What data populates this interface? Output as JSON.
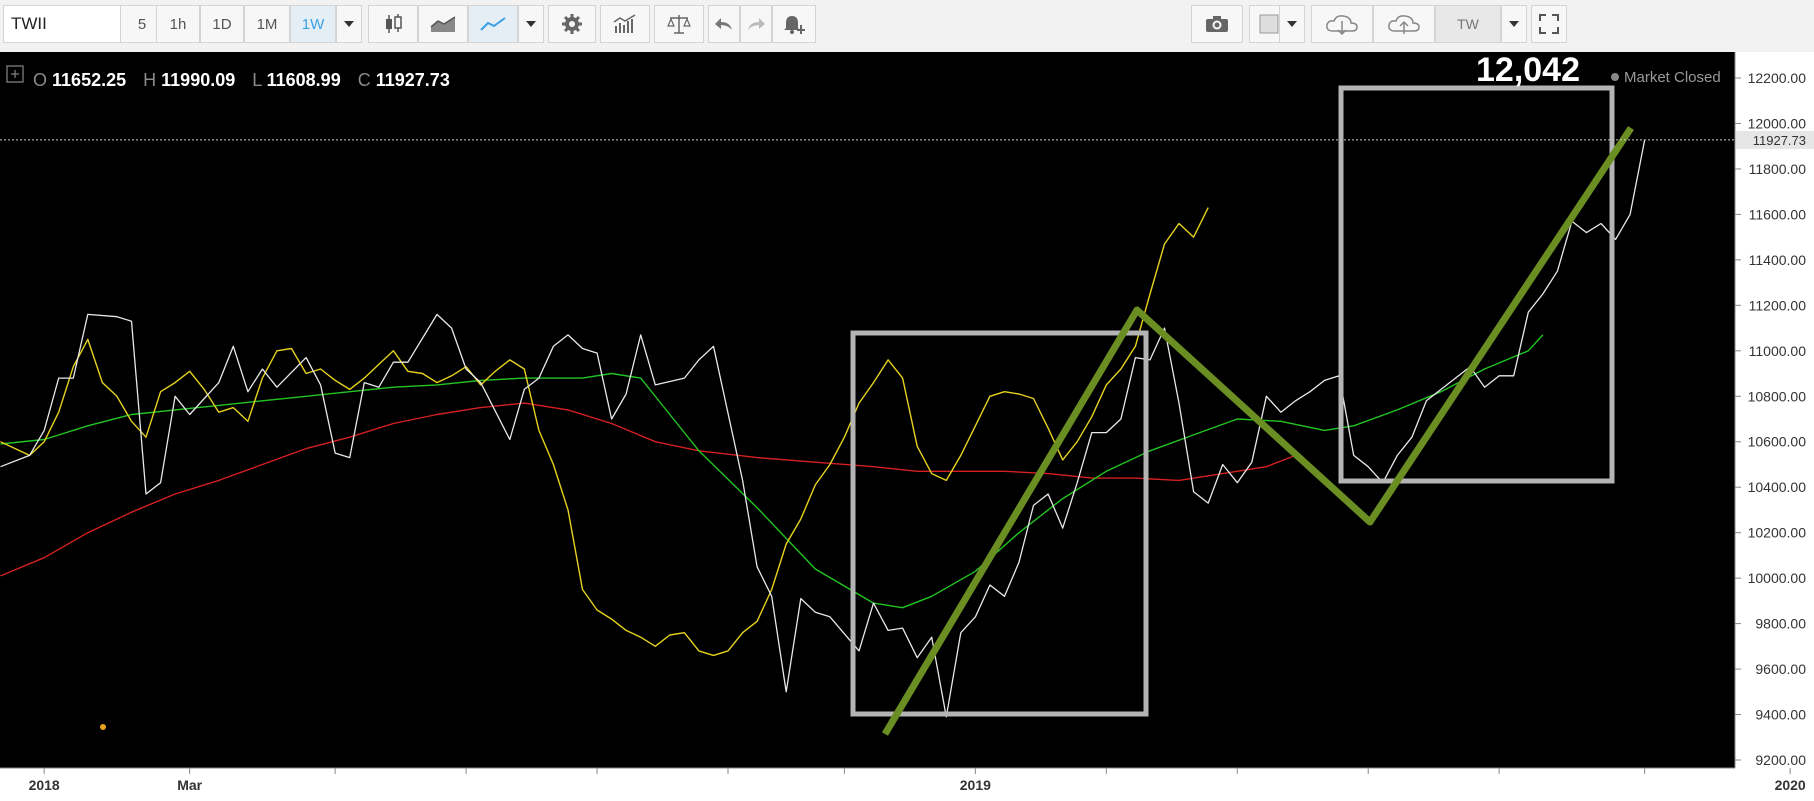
{
  "toolbar": {
    "symbol": "TWII",
    "intervals": [
      "5",
      "1h",
      "1D",
      "1M",
      "1W"
    ],
    "active_interval": "1W",
    "exchange": "TW"
  },
  "ohlc": {
    "o_label": "O",
    "o": "11652.25",
    "h_label": "H",
    "h": "11990.09",
    "l_label": "L",
    "l": "11608.99",
    "c_label": "C",
    "c": "11927.73"
  },
  "annotation": "12,042",
  "status": "Market Closed",
  "last_price_label": "11927.73",
  "colors": {
    "background": "#000000",
    "price": "#e8e8e8",
    "ma_fast": "#e6d21e",
    "ma_mid": "#22c422",
    "ma_slow": "#d42020",
    "trendline": "#6b8e23",
    "box": "#b4b4b4"
  },
  "chart_data": {
    "type": "line",
    "title": "",
    "xlabel": "",
    "ylabel": "",
    "ylim": [
      9150,
      12250
    ],
    "y_ticks": [
      "9200.00",
      "9400.00",
      "9600.00",
      "9800.00",
      "10000.00",
      "10200.00",
      "10400.00",
      "10600.00",
      "10800.00",
      "11000.00",
      "11200.00",
      "11400.00",
      "11600.00",
      "11800.00",
      "12000.00",
      "12200.00"
    ],
    "x_tick_labels": [
      {
        "label": "2018",
        "week": 3
      },
      {
        "label": "Mar",
        "week": 13
      },
      {
        "label": "2019",
        "week": 67
      },
      {
        "label": "2020",
        "week": 123
      }
    ],
    "x_week_range": [
      0,
      125
    ],
    "series": [
      {
        "name": "",
        "key": "price",
        "values": [
          [
            0,
            10490
          ],
          [
            2,
            10540
          ],
          [
            3,
            10650
          ],
          [
            4,
            10880
          ],
          [
            5,
            10880
          ],
          [
            6,
            11160
          ],
          [
            8,
            11150
          ],
          [
            9,
            11130
          ],
          [
            10,
            10370
          ],
          [
            11,
            10420
          ],
          [
            12,
            10800
          ],
          [
            13,
            10720
          ],
          [
            15,
            10860
          ],
          [
            16,
            11020
          ],
          [
            17,
            10820
          ],
          [
            18,
            10920
          ],
          [
            19,
            10840
          ],
          [
            21,
            10970
          ],
          [
            22,
            10850
          ],
          [
            23,
            10550
          ],
          [
            24,
            10530
          ],
          [
            25,
            10860
          ],
          [
            26,
            10840
          ],
          [
            27,
            10950
          ],
          [
            28,
            10950
          ],
          [
            30,
            11160
          ],
          [
            31,
            11100
          ],
          [
            32,
            10920
          ],
          [
            33,
            10860
          ],
          [
            35,
            10610
          ],
          [
            36,
            10830
          ],
          [
            37,
            10880
          ],
          [
            38,
            11020
          ],
          [
            39,
            11070
          ],
          [
            40,
            11010
          ],
          [
            41,
            10990
          ],
          [
            42,
            10700
          ],
          [
            43,
            10810
          ],
          [
            44,
            11070
          ],
          [
            45,
            10850
          ],
          [
            47,
            10880
          ],
          [
            48,
            10960
          ],
          [
            49,
            11020
          ],
          [
            51,
            10430
          ],
          [
            52,
            10050
          ],
          [
            53,
            9920
          ],
          [
            54,
            9500
          ],
          [
            55,
            9910
          ],
          [
            56,
            9850
          ],
          [
            57,
            9830
          ],
          [
            59,
            9680
          ],
          [
            60,
            9890
          ],
          [
            61,
            9770
          ],
          [
            62,
            9780
          ],
          [
            63,
            9650
          ],
          [
            64,
            9740
          ],
          [
            65,
            9390
          ],
          [
            66,
            9760
          ],
          [
            67,
            9830
          ],
          [
            68,
            9970
          ],
          [
            69,
            9920
          ],
          [
            70,
            10070
          ],
          [
            71,
            10320
          ],
          [
            72,
            10370
          ],
          [
            73,
            10220
          ],
          [
            74,
            10420
          ],
          [
            75,
            10640
          ],
          [
            76,
            10640
          ],
          [
            77,
            10700
          ],
          [
            78,
            10970
          ],
          [
            79,
            10960
          ],
          [
            80,
            11100
          ],
          [
            81,
            10770
          ],
          [
            82,
            10380
          ],
          [
            83,
            10330
          ],
          [
            84,
            10500
          ],
          [
            85,
            10420
          ],
          [
            86,
            10510
          ],
          [
            87,
            10800
          ],
          [
            88,
            10730
          ],
          [
            89,
            10780
          ],
          [
            90,
            10820
          ],
          [
            91,
            10870
          ],
          [
            92,
            10890
          ],
          [
            93,
            10540
          ],
          [
            94,
            10490
          ],
          [
            95,
            10420
          ],
          [
            96,
            10540
          ],
          [
            97,
            10620
          ],
          [
            98,
            10780
          ],
          [
            99,
            10830
          ],
          [
            101,
            10930
          ],
          [
            102,
            10840
          ],
          [
            103,
            10890
          ],
          [
            104,
            10890
          ],
          [
            105,
            11170
          ],
          [
            106,
            11250
          ],
          [
            107,
            11350
          ],
          [
            108,
            11570
          ],
          [
            109,
            11520
          ],
          [
            110,
            11560
          ],
          [
            111,
            11490
          ],
          [
            112,
            11600
          ],
          [
            113,
            11928
          ]
        ]
      },
      {
        "name": "",
        "key": "ma_fast",
        "values": [
          [
            0,
            10600
          ],
          [
            2,
            10540
          ],
          [
            3,
            10600
          ],
          [
            4,
            10730
          ],
          [
            5,
            10930
          ],
          [
            6,
            11050
          ],
          [
            7,
            10860
          ],
          [
            8,
            10800
          ],
          [
            9,
            10690
          ],
          [
            10,
            10620
          ],
          [
            11,
            10820
          ],
          [
            12,
            10860
          ],
          [
            13,
            10910
          ],
          [
            14,
            10830
          ],
          [
            15,
            10730
          ],
          [
            16,
            10750
          ],
          [
            17,
            10690
          ],
          [
            18,
            10880
          ],
          [
            19,
            11000
          ],
          [
            20,
            11010
          ],
          [
            21,
            10900
          ],
          [
            22,
            10920
          ],
          [
            23,
            10870
          ],
          [
            24,
            10830
          ],
          [
            25,
            10880
          ],
          [
            26,
            10940
          ],
          [
            27,
            11000
          ],
          [
            28,
            10910
          ],
          [
            29,
            10900
          ],
          [
            30,
            10860
          ],
          [
            31,
            10890
          ],
          [
            32,
            10930
          ],
          [
            33,
            10850
          ],
          [
            34,
            10910
          ],
          [
            35,
            10960
          ],
          [
            36,
            10920
          ],
          [
            37,
            10650
          ],
          [
            38,
            10500
          ],
          [
            39,
            10300
          ],
          [
            40,
            9950
          ],
          [
            41,
            9860
          ],
          [
            42,
            9820
          ],
          [
            43,
            9770
          ],
          [
            44,
            9740
          ],
          [
            45,
            9700
          ],
          [
            46,
            9750
          ],
          [
            47,
            9760
          ],
          [
            48,
            9680
          ],
          [
            49,
            9660
          ],
          [
            50,
            9680
          ],
          [
            51,
            9760
          ],
          [
            52,
            9810
          ],
          [
            53,
            9950
          ],
          [
            54,
            10150
          ],
          [
            55,
            10260
          ],
          [
            56,
            10410
          ],
          [
            57,
            10500
          ],
          [
            58,
            10620
          ],
          [
            59,
            10770
          ],
          [
            60,
            10860
          ],
          [
            61,
            10960
          ],
          [
            62,
            10880
          ],
          [
            63,
            10580
          ],
          [
            64,
            10460
          ],
          [
            65,
            10430
          ],
          [
            66,
            10540
          ],
          [
            67,
            10670
          ],
          [
            68,
            10800
          ],
          [
            69,
            10820
          ],
          [
            70,
            10810
          ],
          [
            71,
            10790
          ],
          [
            72,
            10660
          ],
          [
            73,
            10520
          ],
          [
            74,
            10600
          ],
          [
            75,
            10710
          ],
          [
            76,
            10850
          ],
          [
            77,
            10920
          ],
          [
            78,
            11020
          ],
          [
            79,
            11250
          ],
          [
            80,
            11470
          ],
          [
            81,
            11560
          ],
          [
            82,
            11500
          ],
          [
            83,
            11630
          ]
        ]
      },
      {
        "name": "",
        "key": "ma_mid",
        "values": [
          [
            0,
            10590
          ],
          [
            3,
            10610
          ],
          [
            6,
            10670
          ],
          [
            9,
            10720
          ],
          [
            12,
            10740
          ],
          [
            15,
            10760
          ],
          [
            18,
            10780
          ],
          [
            21,
            10800
          ],
          [
            24,
            10820
          ],
          [
            27,
            10840
          ],
          [
            30,
            10850
          ],
          [
            33,
            10870
          ],
          [
            36,
            10880
          ],
          [
            40,
            10880
          ],
          [
            42,
            10900
          ],
          [
            44,
            10880
          ],
          [
            46,
            10720
          ],
          [
            48,
            10560
          ],
          [
            52,
            10310
          ],
          [
            56,
            10040
          ],
          [
            60,
            9890
          ],
          [
            62,
            9870
          ],
          [
            64,
            9920
          ],
          [
            67,
            10030
          ],
          [
            70,
            10200
          ],
          [
            73,
            10350
          ],
          [
            76,
            10470
          ],
          [
            79,
            10560
          ],
          [
            82,
            10630
          ],
          [
            85,
            10700
          ],
          [
            88,
            10690
          ],
          [
            91,
            10650
          ],
          [
            93,
            10670
          ],
          [
            96,
            10740
          ],
          [
            99,
            10820
          ],
          [
            102,
            10920
          ],
          [
            105,
            11000
          ],
          [
            106,
            11070
          ]
        ]
      },
      {
        "name": "",
        "key": "ma_slow",
        "values": [
          [
            0,
            10010
          ],
          [
            3,
            10090
          ],
          [
            6,
            10200
          ],
          [
            9,
            10290
          ],
          [
            12,
            10370
          ],
          [
            15,
            10430
          ],
          [
            18,
            10500
          ],
          [
            21,
            10570
          ],
          [
            24,
            10620
          ],
          [
            27,
            10680
          ],
          [
            30,
            10720
          ],
          [
            33,
            10750
          ],
          [
            36,
            10770
          ],
          [
            39,
            10740
          ],
          [
            42,
            10680
          ],
          [
            45,
            10600
          ],
          [
            48,
            10560
          ],
          [
            52,
            10530
          ],
          [
            56,
            10510
          ],
          [
            60,
            10490
          ],
          [
            63,
            10470
          ],
          [
            66,
            10470
          ],
          [
            69,
            10470
          ],
          [
            72,
            10460
          ],
          [
            75,
            10440
          ],
          [
            78,
            10440
          ],
          [
            81,
            10430
          ],
          [
            84,
            10460
          ],
          [
            87,
            10490
          ],
          [
            89,
            10540
          ]
        ]
      }
    ]
  }
}
